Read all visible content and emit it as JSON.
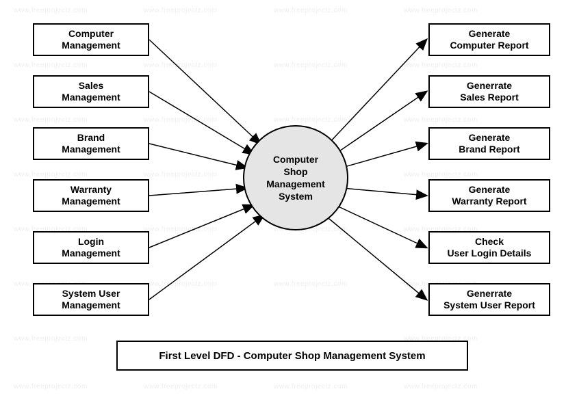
{
  "left_boxes": [
    {
      "l1": "Computer",
      "l2": "Management"
    },
    {
      "l1": "Sales",
      "l2": "Management"
    },
    {
      "l1": "Brand",
      "l2": "Management"
    },
    {
      "l1": "Warranty",
      "l2": "Management"
    },
    {
      "l1": "Login",
      "l2": "Management"
    },
    {
      "l1": "System User",
      "l2": "Management"
    }
  ],
  "right_boxes": [
    {
      "l1": "Generate",
      "l2": "Computer Report"
    },
    {
      "l1": "Generrate",
      "l2": "Sales Report"
    },
    {
      "l1": "Generate",
      "l2": "Brand Report"
    },
    {
      "l1": "Generate",
      "l2": "Warranty Report"
    },
    {
      "l1": "Check",
      "l2": "User Login Details"
    },
    {
      "l1": "Generrate",
      "l2": "System User Report"
    }
  ],
  "center": {
    "l1": "Computer",
    "l2": "Shop",
    "l3": "Management",
    "l4": "System"
  },
  "title": "First Level DFD -  Computer Shop Management System",
  "watermark": "www.freeprojectz.com"
}
